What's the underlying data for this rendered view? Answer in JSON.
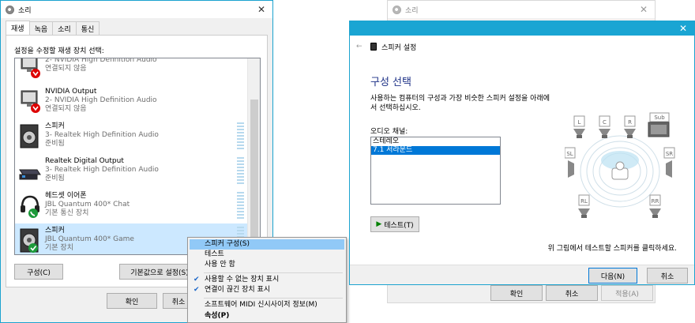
{
  "sound_dialog": {
    "title": "소리",
    "tabs": [
      "재생",
      "녹음",
      "소리",
      "통신"
    ],
    "panel_label": "설정을 수정할 재생 장치 선택:",
    "devices": [
      {
        "name": "",
        "sub": "2- NVIDIA High Definition Audio",
        "status": "연결되지 않음",
        "icon": "monitor-icon",
        "badge": "disconnected"
      },
      {
        "name": "NVIDIA Output",
        "sub": "2- NVIDIA High Definition Audio",
        "status": "연결되지 않음",
        "icon": "monitor-icon",
        "badge": "disconnected"
      },
      {
        "name": "스피커",
        "sub": "3- Realtek High Definition Audio",
        "status": "준비됨",
        "icon": "speaker-icon",
        "badge": ""
      },
      {
        "name": "Realtek Digital Output",
        "sub": "3- Realtek High Definition Audio",
        "status": "준비됨",
        "icon": "digital-output-icon",
        "badge": ""
      },
      {
        "name": "헤드셋 이어폰",
        "sub": "JBL Quantum 400* Chat",
        "status": "기본 통신 장치",
        "icon": "headset-icon",
        "badge": "phone"
      },
      {
        "name": "스피커",
        "sub": "JBL Quantum 400* Game",
        "status": "기본 장치",
        "icon": "speaker-icon",
        "badge": "default"
      }
    ],
    "configure_label": "구성(C)",
    "set_default_label": "기본값으로 설정(S)",
    "ok_label": "확인",
    "cancel_label": "취소"
  },
  "context_menu": {
    "items": [
      {
        "label": "스피커 구성(S)",
        "checked": false,
        "highlighted": true,
        "bold": false
      },
      {
        "label": "테스트",
        "checked": false,
        "highlighted": false,
        "bold": false
      },
      {
        "label": "사용 안 함",
        "checked": false,
        "highlighted": false,
        "bold": false
      },
      {
        "label": "사용할 수 없는 장치 표시",
        "checked": true,
        "highlighted": false,
        "bold": false
      },
      {
        "label": "연결이 끊긴 장치 표시",
        "checked": true,
        "highlighted": false,
        "bold": false
      },
      {
        "label": "소프트웨어 MIDI 신시사이저 정보(M)",
        "checked": false,
        "highlighted": false,
        "bold": false
      },
      {
        "label": "속성(P)",
        "checked": false,
        "highlighted": false,
        "bold": true
      }
    ]
  },
  "background_dialog": {
    "title": "소리",
    "ok_label": "확인",
    "cancel_label": "취소",
    "apply_label": "적용(A)"
  },
  "speaker_setup": {
    "title": "스피커 설정",
    "heading": "구성 선택",
    "description": "사용하는 컴퓨터의 구성과 가장 비슷한 스피커 설정을 아래에서 선택하십시오.",
    "channel_label": "오디오 채널:",
    "options": [
      "스테레오",
      "7.1 서라운드"
    ],
    "selected_option": "7.1 서라운드",
    "test_label": "테스트(T)",
    "hint": "위 그림에서 테스트할 스피커를 클릭하세요.",
    "next_label": "다음(N)",
    "cancel_label": "취소",
    "speaker_labels": {
      "l": "L",
      "c": "C",
      "r": "R",
      "sub": "Sub",
      "sl": "SL",
      "sr": "SR",
      "rl": "RL",
      "rr": "RR"
    }
  },
  "colors": {
    "accent": "#1aa5d3",
    "selection": "#0078d7",
    "list_selection": "#cce8ff",
    "menu_highlight": "#91c9f7",
    "heading": "#1e3287"
  }
}
